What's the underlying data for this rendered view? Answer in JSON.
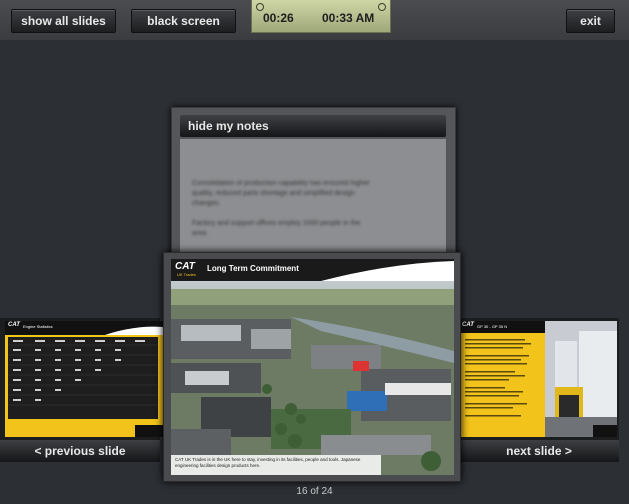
{
  "toolbar": {
    "show_all": "show all slides",
    "black_screen": "black screen",
    "exit": "exit"
  },
  "clock": {
    "elapsed": "00:26",
    "time": "00:33 AM"
  },
  "notes": {
    "toggle_label": "hide my notes",
    "text": "Consolidation of production capability has ensured higher quality, reduced parts shortage and simplified design changes.\n\nFactory and support offices employ 1000 people in the area."
  },
  "slides": {
    "current": {
      "logo": "CAT",
      "logo_sub": "UK Trades",
      "title": "Long Term Commitment",
      "caption": "CAT UK Trades is in the UK here to stay, investing in its facilities, people and tools. Japanese engineering facilities design products here."
    },
    "previous": {
      "label": "< previous slide",
      "logo": "CAT",
      "title": "Engine Statistics"
    },
    "next": {
      "label": "next slide >",
      "logo": "CAT",
      "title": "GP 30 - GP 35 N"
    }
  },
  "counter": "16 of 24",
  "colors": {
    "accent_yellow": "#f2c31b",
    "clock_green": "#b9c190"
  }
}
